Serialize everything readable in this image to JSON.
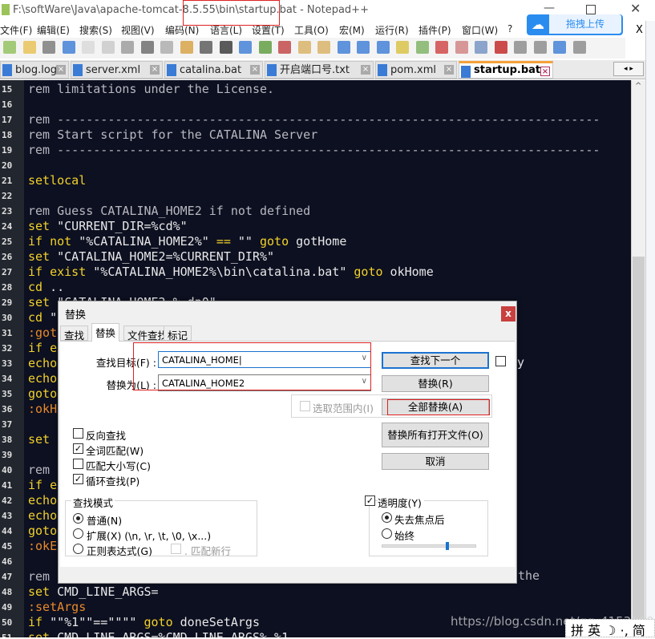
{
  "window": {
    "title": "F:\\softWare\\Java\\apache-tomcat-8.5.55\\bin\\startup.bat - Notepad++",
    "upload_button": "拖拽上传",
    "close_menu": "X"
  },
  "menu": [
    "文件(F)",
    "编辑(E)",
    "搜索(S)",
    "视图(V)",
    "编码(N)",
    "语言(L)",
    "设置(T)",
    "工具(O)",
    "宏(M)",
    "运行(R)",
    "插件(P)",
    "窗口(W)",
    "?"
  ],
  "tabs": [
    {
      "label": "blog.log"
    },
    {
      "label": "server.xml"
    },
    {
      "label": "catalina.bat"
    },
    {
      "label": "开启端口号.txt"
    },
    {
      "label": "pom.xml"
    },
    {
      "label": "startup.bat",
      "active": true
    }
  ],
  "editor": {
    "lines": [
      {
        "n": "15",
        "parts": [
          [
            "rem",
            "rem limitations under the License."
          ]
        ]
      },
      {
        "n": "16",
        "parts": []
      },
      {
        "n": "17",
        "parts": [
          [
            "rem",
            "rem ---------------------------------------------------------------------------"
          ]
        ]
      },
      {
        "n": "18",
        "parts": [
          [
            "rem",
            "rem Start script for the CATALINA Server"
          ]
        ]
      },
      {
        "n": "19",
        "parts": [
          [
            "rem",
            "rem ---------------------------------------------------------------------------"
          ]
        ]
      },
      {
        "n": "20",
        "parts": []
      },
      {
        "n": "21",
        "parts": [
          [
            "kw",
            "setlocal"
          ]
        ]
      },
      {
        "n": "22",
        "parts": []
      },
      {
        "n": "23",
        "parts": [
          [
            "rem",
            "rem Guess CATALINA_HOME2 if not defined"
          ]
        ]
      },
      {
        "n": "24",
        "parts": [
          [
            "kw",
            "set"
          ],
          [
            "t",
            " \"CURRENT_DIR=%cd%\""
          ]
        ]
      },
      {
        "n": "25",
        "parts": [
          [
            "kw",
            "if not"
          ],
          [
            "t",
            " \"%CATALINA_HOME2%\" "
          ],
          [
            "kw",
            "=="
          ],
          [
            "t",
            " \"\" "
          ],
          [
            "kw",
            "goto"
          ],
          [
            "t",
            " gotHome"
          ]
        ]
      },
      {
        "n": "26",
        "parts": [
          [
            "kw",
            "set"
          ],
          [
            "t",
            " \"CATALINA_HOME2=%CURRENT_DIR%\""
          ]
        ]
      },
      {
        "n": "27",
        "parts": [
          [
            "kw",
            "if exist"
          ],
          [
            "t",
            " \"%CATALINA_HOME2%\\bin\\catalina.bat\" "
          ],
          [
            "kw",
            "goto"
          ],
          [
            "t",
            " okHome"
          ]
        ]
      },
      {
        "n": "28",
        "parts": [
          [
            "kw",
            "cd"
          ],
          [
            "t",
            " .."
          ]
        ]
      },
      {
        "n": "29",
        "parts": [
          [
            "kw",
            "set"
          ],
          [
            "t",
            " \"CATALINA_HOME2=%~dp0\""
          ]
        ]
      },
      {
        "n": "30",
        "parts": [
          [
            "kw",
            "cd"
          ],
          [
            "t",
            " \""
          ]
        ]
      },
      {
        "n": "31",
        "parts": [
          [
            "lbl",
            ":gotHome"
          ]
        ]
      },
      {
        "n": "32",
        "parts": [
          [
            "kw",
            "if exist"
          ]
        ]
      },
      {
        "n": "33",
        "parts": [
          [
            "kw",
            "echo"
          ]
        ]
      },
      {
        "n": "34",
        "parts": [
          [
            "kw",
            "echo"
          ]
        ]
      },
      {
        "n": "35",
        "parts": [
          [
            "kw",
            "goto"
          ]
        ]
      },
      {
        "n": "36",
        "parts": [
          [
            "lbl",
            ":okHome"
          ]
        ]
      },
      {
        "n": "37",
        "parts": []
      },
      {
        "n": "38",
        "parts": [
          [
            "kw",
            "set"
          ]
        ]
      },
      {
        "n": "39",
        "parts": []
      },
      {
        "n": "40",
        "parts": [
          [
            "rem",
            "rem C"
          ]
        ]
      },
      {
        "n": "41",
        "parts": [
          [
            "kw",
            "if exist"
          ]
        ]
      },
      {
        "n": "42",
        "parts": [
          [
            "kw",
            "echo"
          ]
        ]
      },
      {
        "n": "43",
        "parts": [
          [
            "kw",
            "echo"
          ]
        ]
      },
      {
        "n": "44",
        "parts": [
          [
            "kw",
            "goto"
          ]
        ]
      },
      {
        "n": "45",
        "parts": [
          [
            "lbl",
            ":okExec"
          ]
        ]
      },
      {
        "n": "46",
        "parts": []
      },
      {
        "n": "47",
        "parts": [
          [
            "rem",
            "rem C"
          ]
        ]
      },
      {
        "n": "48",
        "parts": [
          [
            "kw",
            "set"
          ],
          [
            "t",
            " CMD_LINE_ARGS="
          ]
        ]
      },
      {
        "n": "49",
        "parts": [
          [
            "lbl",
            ":setArgs"
          ]
        ]
      },
      {
        "n": "50",
        "parts": [
          [
            "kw",
            "if"
          ],
          [
            "t",
            " \"\"%1\"\"==\"\"\"\" "
          ],
          [
            "kw",
            "goto"
          ],
          [
            "t",
            " doneSetArgs"
          ]
        ]
      },
      {
        "n": "51",
        "parts": [
          [
            "kw",
            "set"
          ],
          [
            "t",
            " CMD_LINE_ARGS=%CMD_LINE_ARGS% %1"
          ]
        ]
      }
    ],
    "peek": {
      "line34_tail": "y",
      "line47_tail": "the"
    }
  },
  "dialog": {
    "title": "替换",
    "close": "x",
    "tabs": [
      "查找",
      "替换",
      "文件查找",
      "标记"
    ],
    "active_tab": "替换",
    "find_label": "查找目标(F) :",
    "find_value": "CATALINA_HOME",
    "replace_label": "替换为(L) :",
    "replace_value": "CATALINA_HOME2",
    "buttons": {
      "find_next": "查找下一个",
      "replace": "替换(R)",
      "replace_all": "全部替换(A)",
      "replace_all_open": "替换所有打开文件(O)",
      "cancel": "取消"
    },
    "in_selection": "选取范围内(I)",
    "options": [
      {
        "label": "反向查找",
        "checked": false
      },
      {
        "label": "全词匹配(W)",
        "checked": true
      },
      {
        "label": "匹配大小写(C)",
        "checked": false
      },
      {
        "label": "循环查找(P)",
        "checked": true
      }
    ],
    "search_mode": {
      "title": "查找模式",
      "options": [
        {
          "label": "普通(N)",
          "selected": true
        },
        {
          "label": "扩展(X) (\\n, \\r, \\t, \\0, \\x...)",
          "selected": false
        },
        {
          "label": "正则表达式(G)",
          "selected": false
        }
      ],
      "dot_newline": ". 匹配新行"
    },
    "transparency": {
      "label": "透明度(Y)",
      "checked": true,
      "options": [
        {
          "label": "失去焦点后",
          "selected": true
        },
        {
          "label": "始终",
          "selected": false
        }
      ],
      "level": 0.7
    }
  },
  "watermark": "https://blog.csdn.net/qq_41538097",
  "ime": "拼 英 ☽ ·, 简",
  "colors": {
    "editor_bg": "#0d1021",
    "keyword": "#f2d12a",
    "comment": "#b8b8c0",
    "label": "#e8892a",
    "highlight": "#e02020",
    "accent": "#1a73d0"
  }
}
